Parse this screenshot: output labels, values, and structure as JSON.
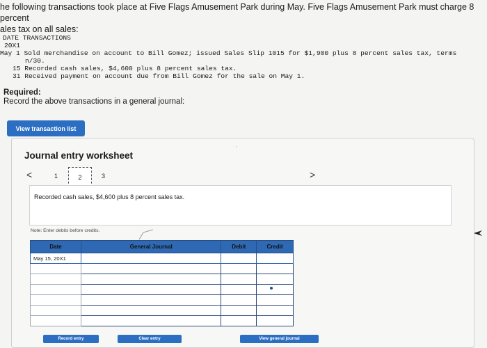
{
  "intro": {
    "line1": "he following transactions took place at Five Flags Amusement Park during May. Five Flags Amusement Park must charge 8 percent",
    "line2": "ales tax on all sales:"
  },
  "transactions": {
    "header": "DATE TRANSACTIONS",
    "year": "20X1",
    "may1_line1": "May 1 Sold merchandise on account to Bill Gomez; issued Sales Slip 1015 for $1,900 plus 8 percent sales tax, terms",
    "may1_line2": "n/30.",
    "may15": "15 Recorded cash sales, $4,600 plus 8 percent sales tax.",
    "may31": "31 Received payment on account due from Bill Gomez for the sale on May 1."
  },
  "required": {
    "label": "Required:",
    "text": "Record the above transactions in a general journal:"
  },
  "buttons": {
    "view_transaction_list": "View transaction list",
    "record_entry": "Record entry",
    "clear_entry": "Clear entry",
    "view_general_journal": "View general journal"
  },
  "worksheet": {
    "title": "Journal entry worksheet",
    "prev": "<",
    "next": ">",
    "pages": [
      "1",
      "2",
      "3"
    ],
    "current_page": "2",
    "description": "Recorded cash sales, $4,600 plus 8 percent sales tax.",
    "note": "Note: Enter debits before credits."
  },
  "journal_table": {
    "headers": {
      "date": "Date",
      "account": "General Journal",
      "debit": "Debit",
      "credit": "Credit"
    },
    "rows": [
      {
        "date": "May 15, 20X1",
        "account": "",
        "debit": "",
        "credit": ""
      },
      {
        "date": "",
        "account": "",
        "debit": "",
        "credit": ""
      },
      {
        "date": "",
        "account": "",
        "debit": "",
        "credit": ""
      },
      {
        "date": "",
        "account": "",
        "debit": "",
        "credit": ""
      },
      {
        "date": "",
        "account": "",
        "debit": "",
        "credit": ""
      },
      {
        "date": "",
        "account": "",
        "debit": "",
        "credit": ""
      },
      {
        "date": "",
        "account": "",
        "debit": "",
        "credit": ""
      }
    ]
  },
  "icons": {
    "prev": "chevron-left-icon",
    "next": "chevron-right-icon",
    "cursor": "mouse-pointer-icon"
  },
  "colors": {
    "accent": "#2c6fc2",
    "table_header": "#2f69b3"
  }
}
